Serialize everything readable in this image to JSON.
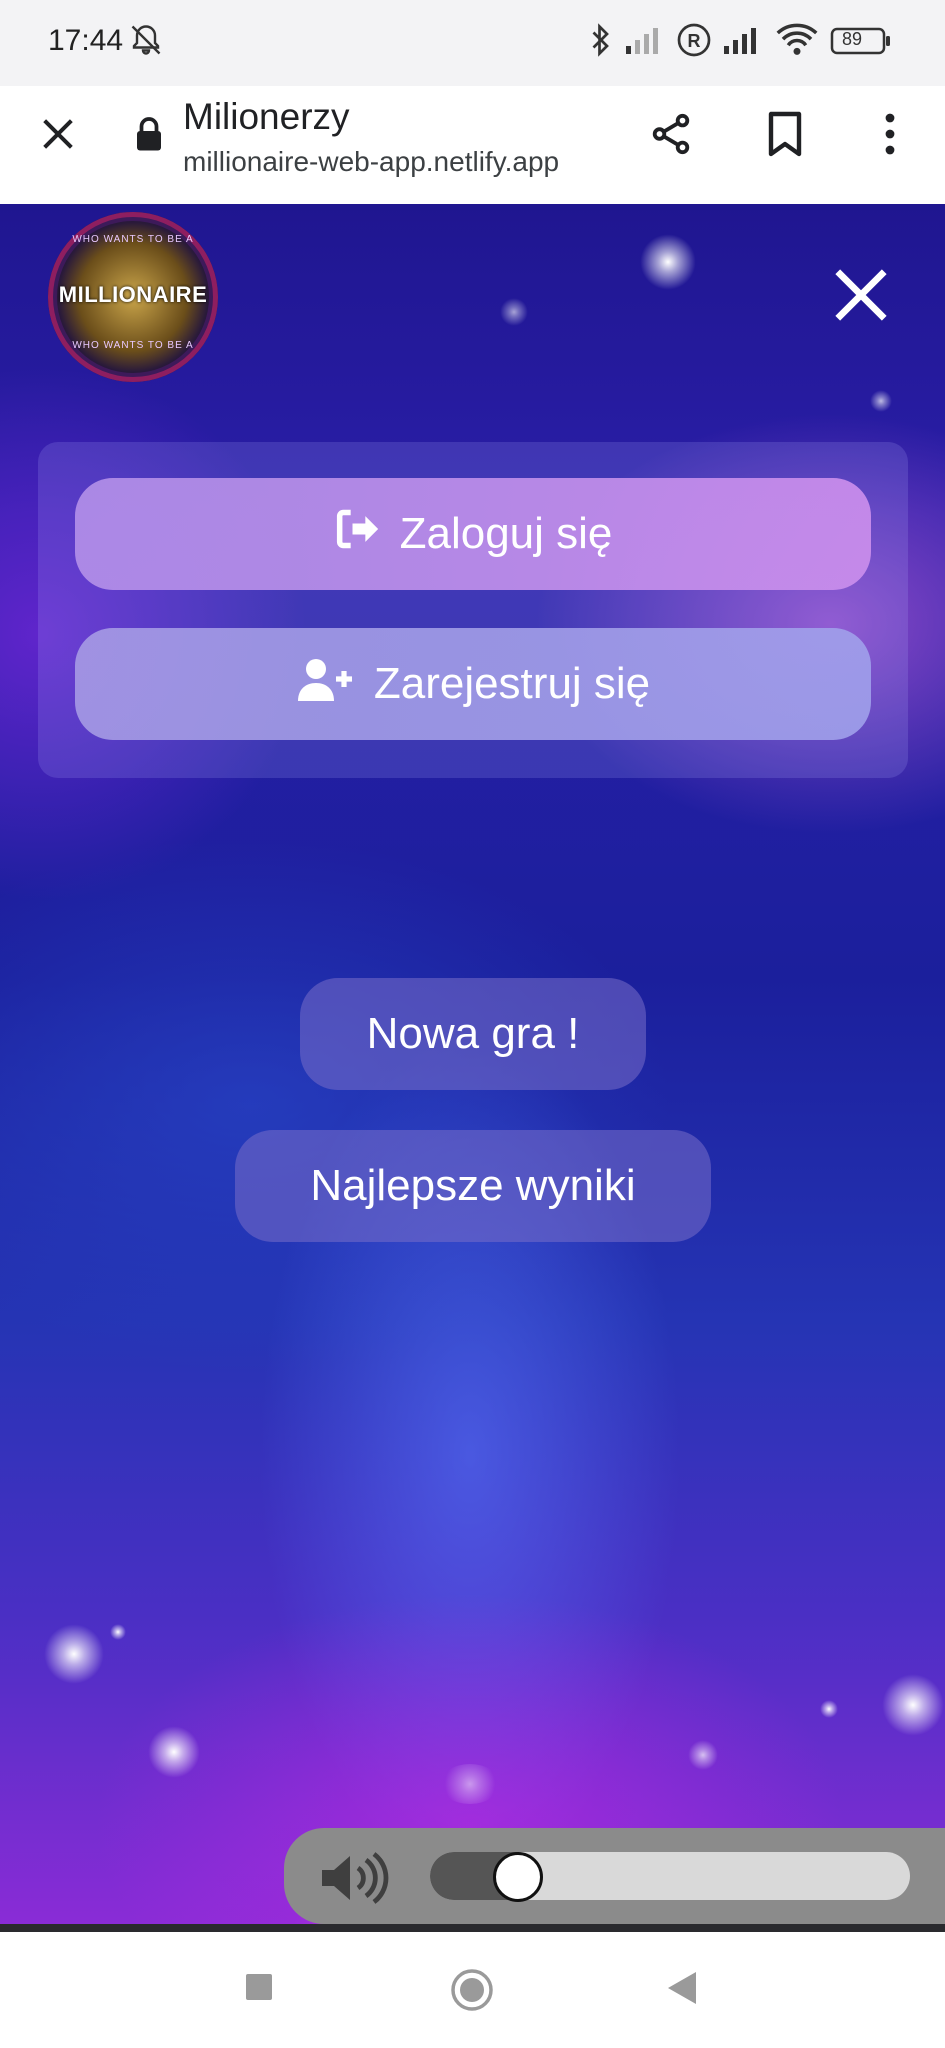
{
  "status_bar": {
    "time": "17:44",
    "battery": "89",
    "icons": [
      "bell-off-icon",
      "bluetooth-icon",
      "signal-icon",
      "registered-icon",
      "signal-icon",
      "wifi-icon",
      "battery-icon"
    ]
  },
  "browser": {
    "title": "Milionerzy",
    "url": "millionaire-web-app.netlify.app",
    "icons": [
      "close-icon",
      "lock-icon",
      "share-icon",
      "bookmark-icon",
      "more-icon"
    ]
  },
  "logo": {
    "name": "MILLIONAIRE",
    "ring_text": "WHO WANTS TO BE A"
  },
  "auth": {
    "login_label": "Zaloguj się",
    "register_label": "Zarejestruj się"
  },
  "menu": {
    "new_game_label": "Nowa gra !",
    "best_scores_label": "Najlepsze wyniki"
  },
  "volume": {
    "level": 0.16,
    "icon": "volume-icon"
  },
  "colors": {
    "bg_top": "#1f1690",
    "bg_bottom": "#8a2cd6",
    "button": "#b996eb"
  }
}
